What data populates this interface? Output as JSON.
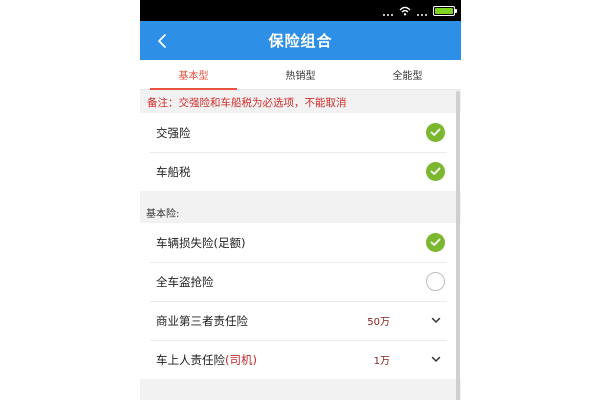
{
  "header": {
    "title": "保险组合",
    "back_icon": "chevron-left-icon"
  },
  "tabs": [
    {
      "label": "基本型",
      "active": true
    },
    {
      "label": "热销型",
      "active": false
    },
    {
      "label": "全能型",
      "active": false
    }
  ],
  "note": "备注：交强险和车船税为必选项，不能取消",
  "required": [
    {
      "label": "交强险",
      "checked": true
    },
    {
      "label": "车船税",
      "checked": true
    }
  ],
  "basic": {
    "header": "基本险:",
    "items": [
      {
        "label": "车辆损失险(足额)",
        "checked": true
      },
      {
        "label": "全车盗抢险",
        "checked": false
      },
      {
        "label": "商业第三者责任险",
        "value": "50万"
      },
      {
        "label_main": "车上人责任险",
        "label_red": "(司机)",
        "value": "1万"
      }
    ]
  },
  "colors": {
    "accent": "#2d8fe6",
    "tab_active": "#e8523e",
    "check": "#7cb82f",
    "note": "#d42b2b"
  }
}
